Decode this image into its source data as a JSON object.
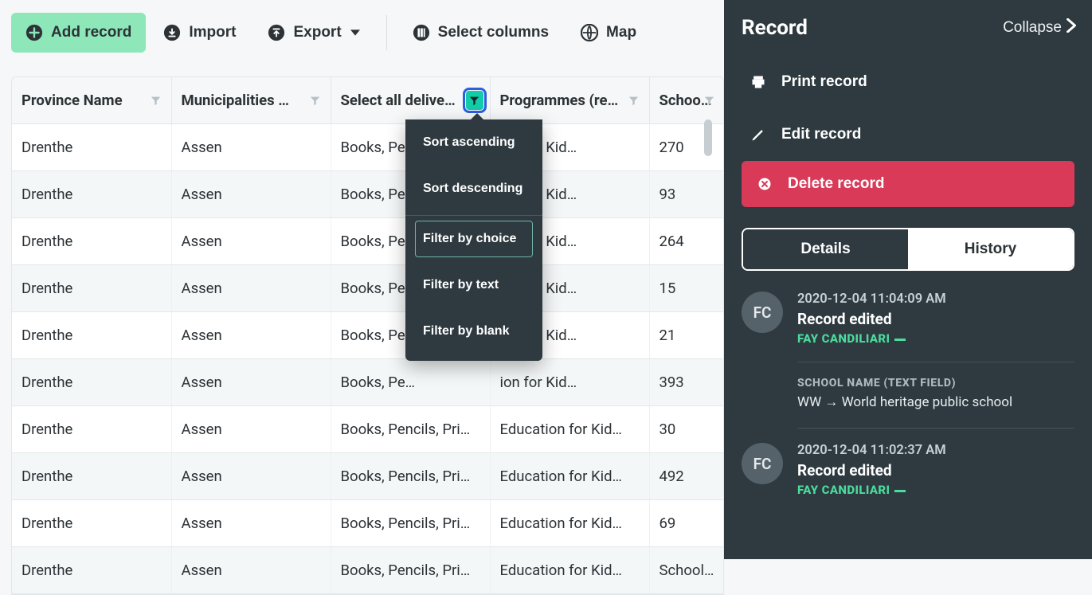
{
  "toolbar": {
    "add": "Add record",
    "import": "Import",
    "export": "Export",
    "select_columns": "Select columns",
    "map": "Map"
  },
  "table": {
    "columns": [
      {
        "label": "Province Name",
        "filter_active": false
      },
      {
        "label": "Municipalities …",
        "filter_active": false
      },
      {
        "label": "Select all delive…",
        "filter_active": true
      },
      {
        "label": "Programmes (re…",
        "filter_active": false
      },
      {
        "label": "School na…",
        "filter_active": false
      }
    ],
    "rows": [
      {
        "province": "Drenthe",
        "muni": "Assen",
        "deliver": "Books, Pe…",
        "prog": "ion for Kid…",
        "school": "270"
      },
      {
        "province": "Drenthe",
        "muni": "Assen",
        "deliver": "Books, Pe…",
        "prog": "ion for Kid…",
        "school": "93"
      },
      {
        "province": "Drenthe",
        "muni": "Assen",
        "deliver": "Books, Pe…",
        "prog": "ion for Kid…",
        "school": "264"
      },
      {
        "province": "Drenthe",
        "muni": "Assen",
        "deliver": "Books, Pe…",
        "prog": "ion for Kid…",
        "school": "15"
      },
      {
        "province": "Drenthe",
        "muni": "Assen",
        "deliver": "Books, Pe…",
        "prog": "ion for Kid…",
        "school": "21"
      },
      {
        "province": "Drenthe",
        "muni": "Assen",
        "deliver": "Books, Pe…",
        "prog": "ion for Kid…",
        "school": "393"
      },
      {
        "province": "Drenthe",
        "muni": "Assen",
        "deliver": "Books, Pencils, Pri…",
        "prog": "Education for Kid…",
        "school": "30"
      },
      {
        "province": "Drenthe",
        "muni": "Assen",
        "deliver": "Books, Pencils, Pri…",
        "prog": "Education for Kid…",
        "school": "492"
      },
      {
        "province": "Drenthe",
        "muni": "Assen",
        "deliver": "Books, Pencils, Pri…",
        "prog": "Education for Kid…",
        "school": "69"
      },
      {
        "province": "Drenthe",
        "muni": "Assen",
        "deliver": "Books, Pencils, Pri…",
        "prog": "Education for Kid…",
        "school": "School…"
      }
    ]
  },
  "dropdown": {
    "sort_asc": "Sort ascending",
    "sort_desc": "Sort descending",
    "filter_choice": "Filter by choice",
    "filter_text": "Filter by text",
    "filter_blank": "Filter by blank"
  },
  "panel": {
    "title": "Record",
    "collapse": "Collapse",
    "print": "Print record",
    "edit": "Edit record",
    "delete": "Delete record",
    "tabs": {
      "details": "Details",
      "history": "History"
    },
    "history": [
      {
        "avatar": "FC",
        "time": "2020-12-04 11:04:09 AM",
        "title": "Record edited",
        "user": "FAY CANDILIARI",
        "change_field": "SCHOOL NAME (TEXT FIELD)",
        "change_value": "WW → World heritage public school"
      },
      {
        "avatar": "FC",
        "time": "2020-12-04 11:02:37 AM",
        "title": "Record edited",
        "user": "FAY CANDILIARI"
      }
    ]
  }
}
